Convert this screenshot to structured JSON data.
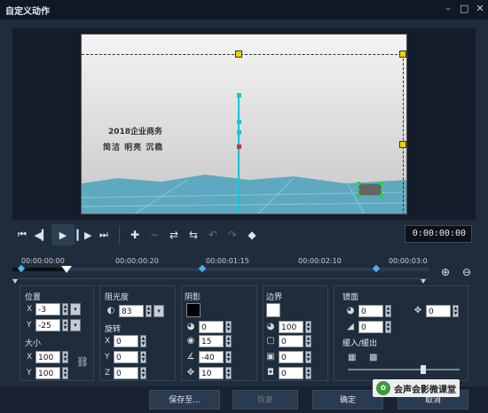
{
  "window": {
    "title": "自定义动作",
    "controls": [
      "minimize-icon",
      "maximize-icon",
      "close-icon"
    ]
  },
  "preview": {
    "slogan_line1": "2018企业商务",
    "slogan_line2": "简洁 明亮 沉稳"
  },
  "transport": {
    "buttons": [
      "go-start-icon",
      "prev-frame-icon",
      "play-icon",
      "next-frame-icon",
      "go-end-icon"
    ],
    "tools": [
      "add-keyframe-icon",
      "remove-keyframe-icon",
      "reverse-icon",
      "swap-icon",
      "prev-keyframe-icon",
      "next-keyframe-icon",
      "fit-icon"
    ],
    "timecode": "0:00:00:00"
  },
  "timeline": {
    "ticks": [
      "00:00:00:00",
      "00:00:00:20",
      "00:00:01:15",
      "00:00:02:10",
      "00:00:03:0"
    ]
  },
  "position": {
    "label": "位置",
    "x_label": "X",
    "x_value": "-3",
    "y_label": "Y",
    "y_value": "-25"
  },
  "size": {
    "label": "大小",
    "x_label": "X",
    "x_value": "100",
    "y_label": "Y",
    "y_value": "100"
  },
  "opacity": {
    "label": "阻光度",
    "value": "83"
  },
  "rotation": {
    "label": "旋转",
    "x_label": "X",
    "x_value": "0",
    "y_label": "Y",
    "y_value": "0",
    "z_label": "Z",
    "z_value": "0"
  },
  "shadow": {
    "label": "阴影",
    "color": "#000000",
    "opacity": "0",
    "blur": "15",
    "angle": "-40",
    "distance": "10"
  },
  "border": {
    "label": "边界",
    "color": "#ffffff",
    "opacity": "100",
    "width": "0",
    "transparency": "0",
    "softness": "0"
  },
  "mirror": {
    "label": "镜面",
    "opacity": "0",
    "distance": "0",
    "offset": "0"
  },
  "fade": {
    "label": "缓入/缓出"
  },
  "footer": {
    "save_as": "保存至...",
    "reset": "恢复",
    "ok": "确定",
    "cancel": "取消"
  },
  "watermark": {
    "text": "会声会影微课堂"
  },
  "colors": {
    "accent": "#16c6d4",
    "handle": "#f2d000",
    "keyframe": "#4ab3ea"
  }
}
